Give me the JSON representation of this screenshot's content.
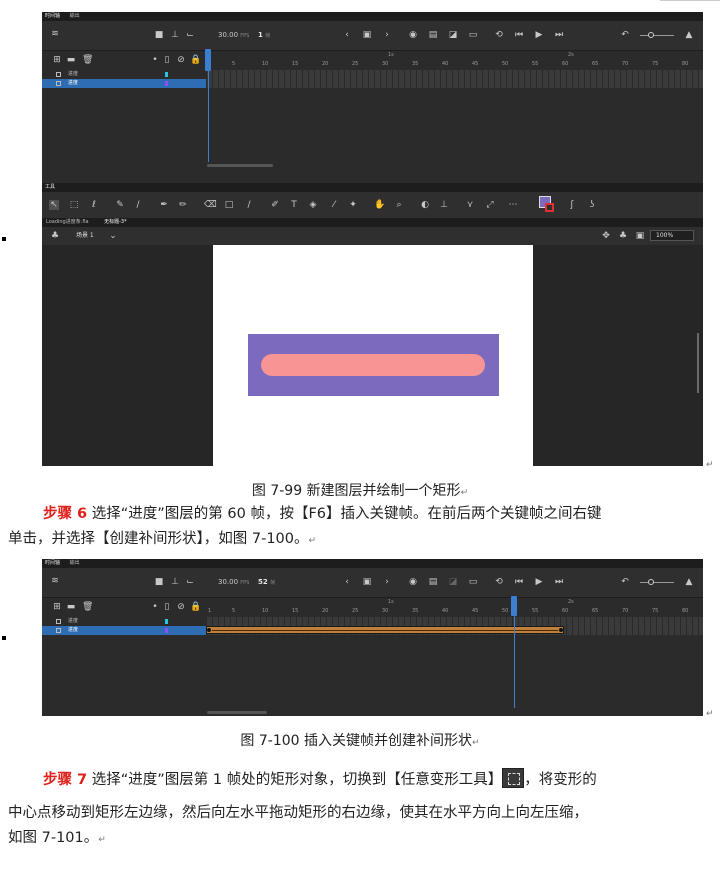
{
  "fig1": {
    "timeline": {
      "tabs": [
        "时间轴",
        "输出"
      ],
      "fps_value": "30.00",
      "fps_unit": "FPS",
      "frame_value": "1",
      "frame_unit": "帧",
      "ruler_seconds": [
        "1s",
        "2s"
      ],
      "ruler_frames": [
        "1",
        "5",
        "10",
        "15",
        "20",
        "25",
        "30",
        "35",
        "40",
        "45",
        "50",
        "55",
        "60",
        "65",
        "70",
        "75",
        "80"
      ],
      "layers": [
        {
          "name": "进度",
          "color": "#29c4e0",
          "selected": false
        },
        {
          "name": "进度",
          "color": "#8a4fff",
          "selected": true
        }
      ]
    },
    "tools_title": "工具",
    "doc_tabs": [
      "Loading进度条.fla",
      "无标题-3*"
    ],
    "scene_label": "场景 1",
    "zoom": "100%",
    "stage_colors": {
      "rect": "#7c6abf",
      "pill": "#f79494"
    }
  },
  "caption1": "图 7-99  新建图层并绘制一个矩形",
  "step6": {
    "label": "步骤 6",
    "line1": " 选择“进度”图层的第 60 帧，按【F6】插入关键帧。在前后两个关键帧之间右键",
    "line2": "单击，并选择【创建补间形状】，如图 7-100。"
  },
  "fig2": {
    "tabs": [
      "时间轴",
      "输出"
    ],
    "fps_value": "30.00",
    "fps_unit": "FPS",
    "frame_value": "52",
    "frame_unit": "帧",
    "ruler_seconds": [
      "1s",
      "2s"
    ],
    "ruler_frames": [
      "1",
      "5",
      "10",
      "15",
      "20",
      "25",
      "30",
      "35",
      "40",
      "45",
      "50",
      "55",
      "60",
      "65",
      "70",
      "75",
      "80"
    ],
    "layers": [
      {
        "name": "进度",
        "color": "#29c4e0",
        "selected": false
      },
      {
        "name": "进度",
        "color": "#8a4fff",
        "selected": true
      }
    ],
    "tween_color": "#c0803a"
  },
  "caption2": "图 7-100  插入关键帧并创建补间形状",
  "step7": {
    "label": "步骤 7",
    "line1a": " 选择“进度”图层第 1 帧处的矩形对象，切换到【任意变形工具】",
    "line1b": "，将变形的",
    "line2": "中心点移动到矩形左边缘，然后向左水平拖动矩形的右边缘，使其在水平方向上向左压缩，",
    "line3": "如图 7-101。"
  }
}
